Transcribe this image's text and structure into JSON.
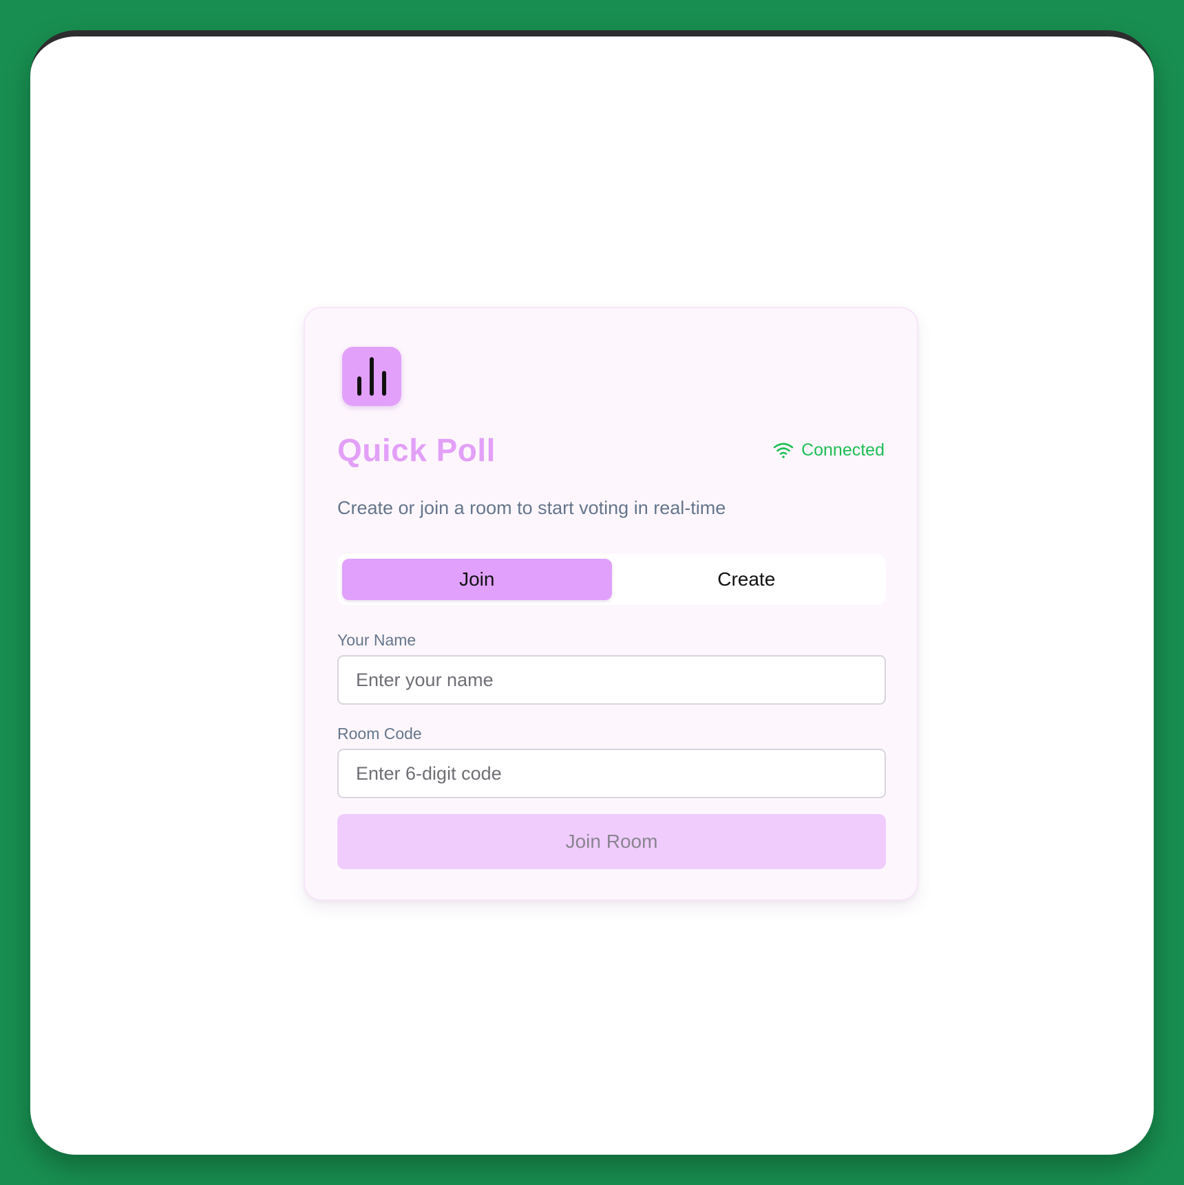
{
  "app": {
    "title": "Quick Poll",
    "subtitle": "Create or join a room to start voting in real-time",
    "logo_icon": "bar-chart-icon"
  },
  "connection": {
    "status_label": "Connected",
    "icon": "wifi-icon",
    "color": "#1ebd53"
  },
  "tabs": [
    {
      "label": "Join",
      "active": true
    },
    {
      "label": "Create",
      "active": false
    }
  ],
  "form": {
    "name_label": "Your Name",
    "name_placeholder": "Enter your name",
    "name_value": "",
    "code_label": "Room Code",
    "code_placeholder": "Enter 6-digit code",
    "code_value": "",
    "submit_label": "Join Room"
  },
  "colors": {
    "background": "#188f50",
    "accent": "#e0a0fb",
    "title": "#e3a0f8",
    "submit_disabled": "#f0ccfd"
  }
}
